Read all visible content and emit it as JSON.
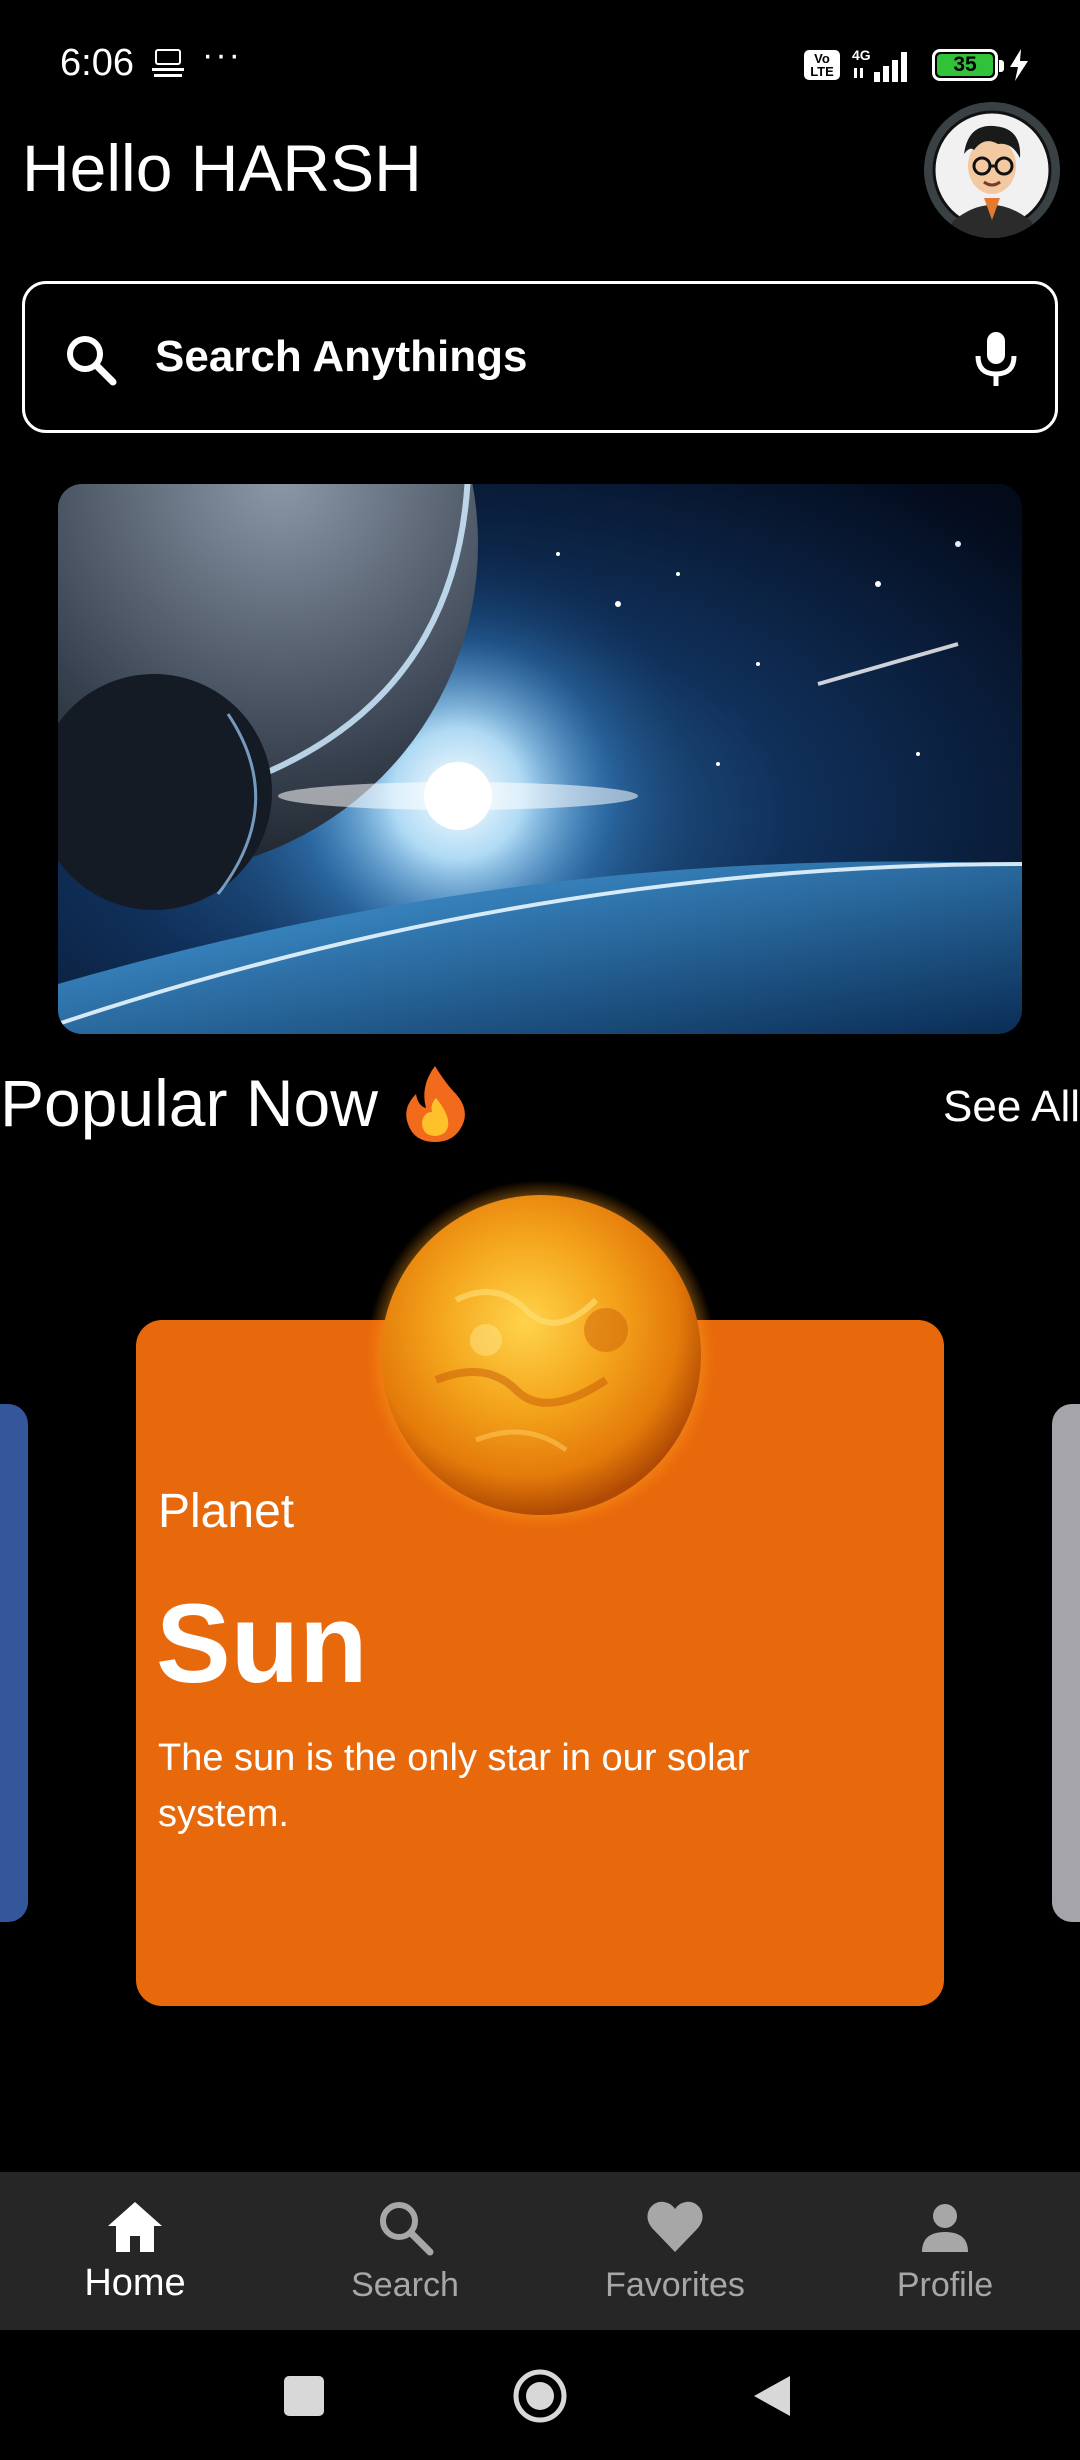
{
  "status_bar": {
    "time": "6:06",
    "dots": "···",
    "volte": "Vo LTE",
    "network": "4G",
    "battery": "35"
  },
  "header": {
    "greeting": "Hello HARSH",
    "avatar_icon": "avatar-cartoon-person"
  },
  "search": {
    "placeholder": "Search Anythings",
    "leading_icon": "search-icon",
    "trailing_icon": "mic-icon"
  },
  "section": {
    "title": "Popular Now",
    "title_icon": "fire-emoji",
    "see_all": "See All"
  },
  "featured_card": {
    "category": "Planet",
    "title": "Sun",
    "description": "The sun is the only star in our solar system.",
    "color": "#e8690c"
  },
  "side_cards": {
    "left_color": "#34569a",
    "right_color": "#a4a4aa"
  },
  "bottom_nav": {
    "items": [
      {
        "label": "Home",
        "icon": "home-icon",
        "active": true
      },
      {
        "label": "Search",
        "icon": "search-icon",
        "active": false
      },
      {
        "label": "Favorites",
        "icon": "heart-icon",
        "active": false
      },
      {
        "label": "Profile",
        "icon": "person-icon",
        "active": false
      }
    ]
  },
  "colors": {
    "background": "#000000",
    "nav_background": "#262626",
    "nav_inactive": "#a7a7a7",
    "accent_orange": "#e8690c"
  }
}
